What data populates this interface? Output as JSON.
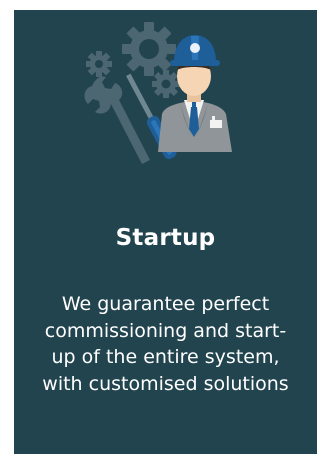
{
  "card": {
    "title": "Startup",
    "description_lines": [
      "We guarantee perfect",
      "commissioning and start-",
      "up of the entire system,",
      "with customised solutions"
    ]
  },
  "icons": {
    "illustration": "engineer-with-tools-icon"
  },
  "colors": {
    "card_background": "#22444f",
    "text": "#ffffff",
    "helmet": "#1f5f99",
    "gear": "#4c6771",
    "suit": "#8f9598",
    "tie": "#1f5f99"
  }
}
